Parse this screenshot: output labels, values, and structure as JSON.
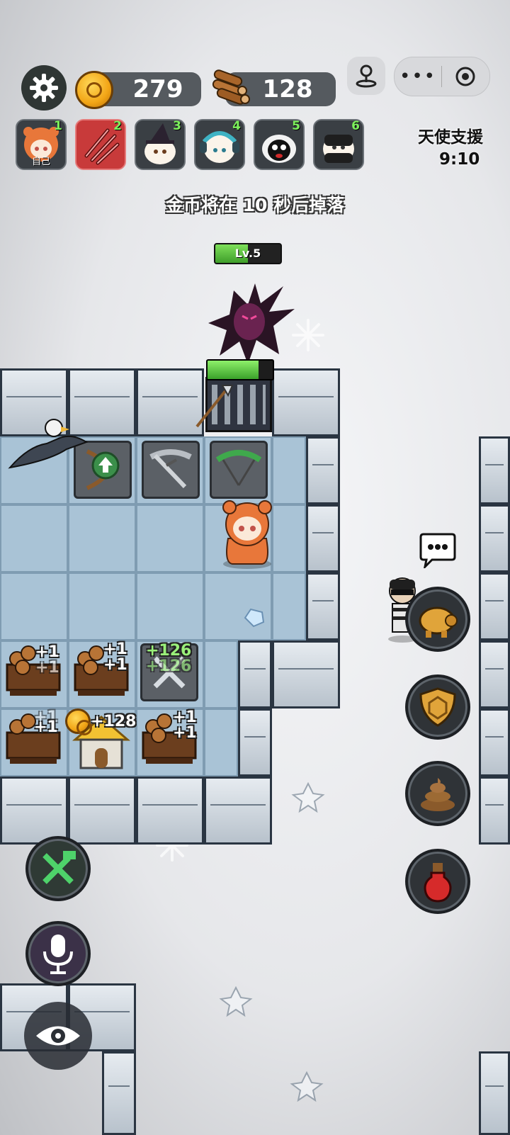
{
  "hud": {
    "coins": "279",
    "wood": "128"
  },
  "players": [
    {
      "number": "1",
      "tag": "自己",
      "active": false
    },
    {
      "number": "2",
      "tag": "",
      "active": true
    },
    {
      "number": "3",
      "tag": "",
      "active": false
    },
    {
      "number": "4",
      "tag": "",
      "active": false
    },
    {
      "number": "5",
      "tag": "",
      "active": false
    },
    {
      "number": "6",
      "tag": "",
      "active": false
    }
  ],
  "angel_support": {
    "title": "天使支援",
    "time": "9:10"
  },
  "notice": "金币将在 10 秒后掉落",
  "enemy": {
    "level_label": "Lv.5",
    "level_fill": 0.5,
    "gate_hp_fill": 0.78
  },
  "bonuses": {
    "wood_a_1": "+1",
    "wood_a_2": "+1",
    "wood_b_1": "+1",
    "wood_b_2": "+1",
    "tools_1": "+126",
    "tools_2": "+126",
    "wood_c_1": "+1",
    "wood_c_2": "+1",
    "house": "+128",
    "wood_d_1": "+1",
    "wood_d_2": "+1"
  },
  "icons": {
    "settings": "gear-icon",
    "coin": "coin-icon",
    "wood": "wood-icon",
    "joystick": "joystick-icon",
    "more": "more-icon",
    "close": "target-icon",
    "chat": "chat-bubble-icon",
    "piggy": "piggy-bank-icon",
    "shield": "shield-icon",
    "poop": "poop-icon",
    "potion": "potion-icon",
    "build": "wrench-hammer-icon",
    "mic": "microphone-icon",
    "eye": "eye-icon"
  },
  "colors": {
    "active_player": "#c83a3a",
    "hp_green": "#6ee04a",
    "bonus_green": "#9af07a"
  }
}
